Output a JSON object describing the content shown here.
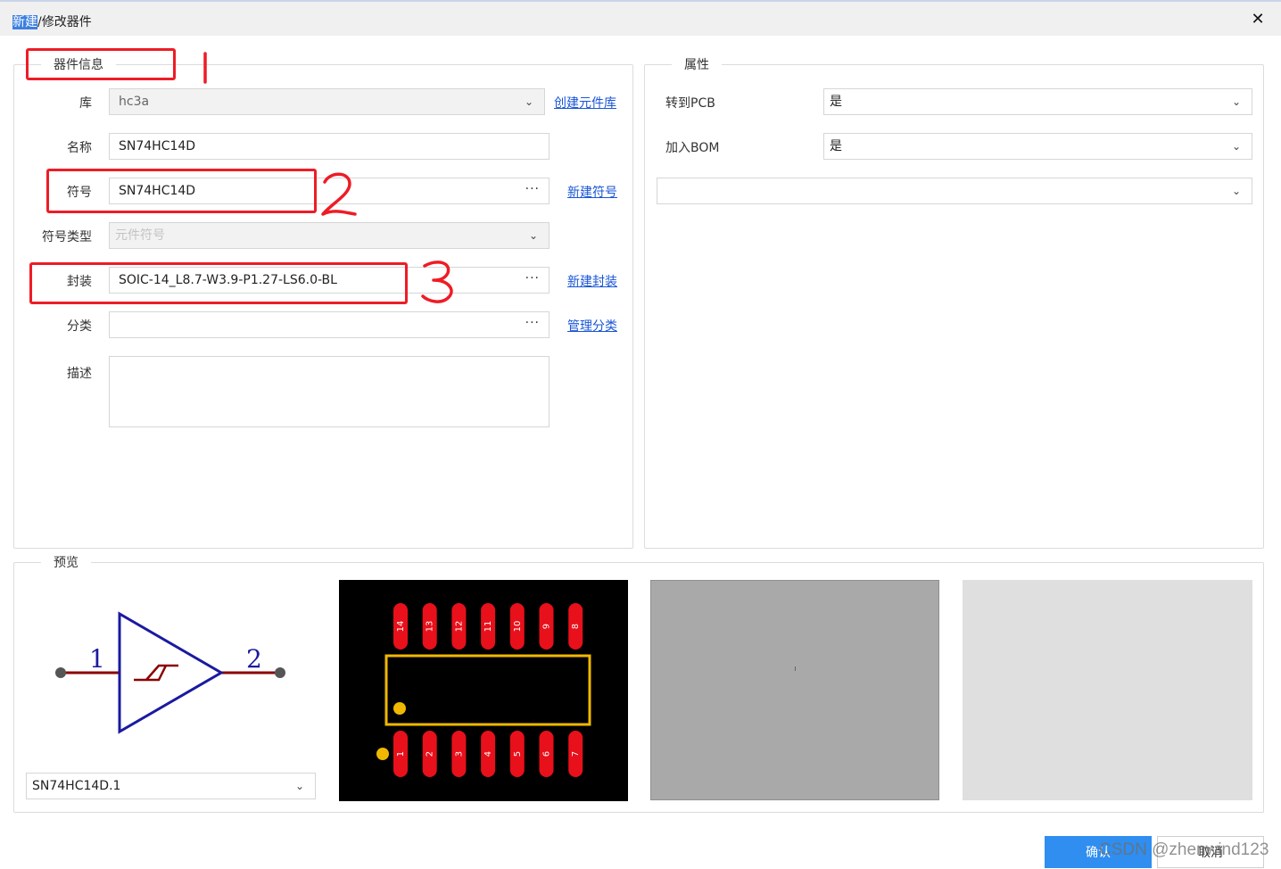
{
  "window": {
    "title_highlight": "新建",
    "title_rest": "/修改器件",
    "close_glyph": "✕"
  },
  "device_info": {
    "legend": "器件信息",
    "fields": {
      "library": {
        "label": "库",
        "value": "hc3a",
        "link": "创建元件库"
      },
      "name": {
        "label": "名称",
        "value": "SN74HC14D"
      },
      "symbol": {
        "label": "符号",
        "value": "SN74HC14D",
        "link": "新建符号"
      },
      "symbol_type": {
        "label": "符号类型",
        "placeholder": "元件符号"
      },
      "footprint": {
        "label": "封装",
        "value": "SOIC-14_L8.7-W3.9-P1.27-LS6.0-BL",
        "link": "新建封装"
      },
      "category": {
        "label": "分类",
        "value": "",
        "link": "管理分类"
      },
      "description": {
        "label": "描述",
        "value": ""
      }
    }
  },
  "attributes": {
    "legend": "属性",
    "to_pcb": {
      "label": "转到PCB",
      "value": "是"
    },
    "add_bom": {
      "label": "加入BOM",
      "value": "是"
    },
    "extra_select": {
      "value": ""
    }
  },
  "preview": {
    "legend": "预览",
    "symbol_pins": [
      "1",
      "2"
    ],
    "symbol_select": "SN74HC14D.1",
    "footprint_top_pins": [
      "14",
      "13",
      "12",
      "11",
      "10",
      "9",
      "8"
    ],
    "footprint_bottom_pins": [
      "1",
      "2",
      "3",
      "4",
      "5",
      "6",
      "7"
    ],
    "colors": {
      "pad": "#e8101a",
      "outline": "#f0b800",
      "schematic_body": "#1a1aa0",
      "schematic_pin": "#8b0000",
      "pcb_background": "#000000",
      "view3d_background": "#a9a9a9",
      "blank_background": "#dfdfdf"
    }
  },
  "annotations": [
    "1",
    "2",
    "3"
  ],
  "buttons": {
    "ok": "确认",
    "cancel": "取消"
  },
  "watermark": "CSDN @zhenwind123",
  "icons": {
    "dropdown": "chevron-down-icon",
    "more": "ellipsis-icon",
    "close": "close-icon"
  }
}
